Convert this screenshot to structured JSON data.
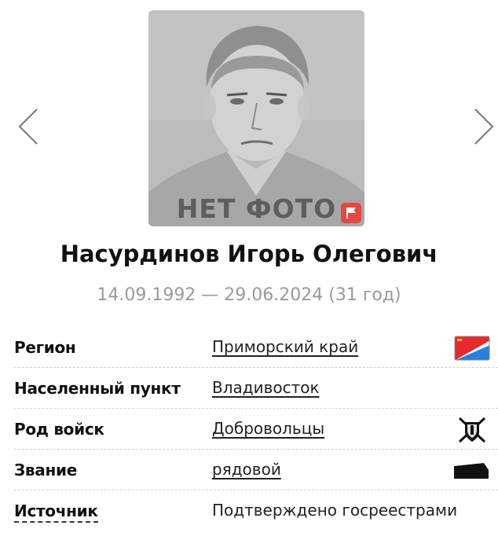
{
  "gallery": {
    "prev_icon": "chevron-left-icon",
    "next_icon": "chevron-right-icon",
    "placeholder_caption": "НЕТ ФОТО",
    "report_icon": "flag-icon",
    "report_color": "#e8473f"
  },
  "person": {
    "name": "Насурдинов Игорь Олегович",
    "dates": "14.09.1992 — 29.06.2024 (31 год)"
  },
  "details": {
    "region": {
      "label": "Регион",
      "value": "Приморский край",
      "icon": "region-flag-icon"
    },
    "settlement": {
      "label": "Населенный пункт",
      "value": "Владивосток"
    },
    "branch": {
      "label": "Род войск",
      "value": "Добровольцы",
      "icon": "volunteers-emblem-icon"
    },
    "rank": {
      "label": "Звание",
      "value": "рядовой",
      "icon": "rank-insignia-icon"
    },
    "source": {
      "label": "Источник",
      "value": "Подтверждено госреестрами"
    }
  }
}
